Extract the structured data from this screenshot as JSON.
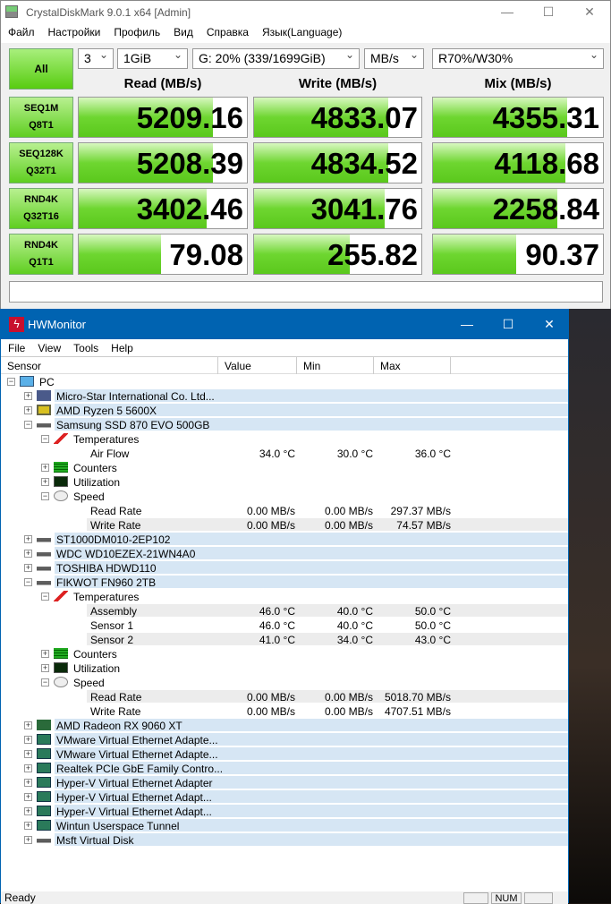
{
  "cdm": {
    "title": "CrystalDiskMark 9.0.1 x64 [Admin]",
    "menu": [
      "Файл",
      "Настройки",
      "Профиль",
      "Вид",
      "Справка",
      "Язык(Language)"
    ],
    "all_label": "All",
    "count": "3",
    "size": "1GiB",
    "drive": "G: 20% (339/1699GiB)",
    "unit": "MB/s",
    "mix_ratio": "R70%/W30%",
    "headers": [
      "Read (MB/s)",
      "Write (MB/s)",
      "Mix (MB/s)"
    ],
    "tests": [
      {
        "l1": "SEQ1M",
        "l2": "Q8T1",
        "values": [
          "5209.16",
          "4833.07",
          "4355.31"
        ],
        "fill": [
          0.8,
          0.8,
          0.79
        ]
      },
      {
        "l1": "SEQ128K",
        "l2": "Q32T1",
        "values": [
          "5208.39",
          "4834.52",
          "4118.68"
        ],
        "fill": [
          0.8,
          0.8,
          0.78
        ]
      },
      {
        "l1": "RND4K",
        "l2": "Q32T16",
        "values": [
          "3402.46",
          "3041.76",
          "2258.84"
        ],
        "fill": [
          0.76,
          0.78,
          0.73
        ]
      },
      {
        "l1": "RND4K",
        "l2": "Q1T1",
        "values": [
          "79.08",
          "255.82",
          "90.37"
        ],
        "fill": [
          0.49,
          0.57,
          0.49
        ]
      }
    ],
    "comment": ""
  },
  "hw": {
    "title": "HWMonitor",
    "menu": [
      "File",
      "View",
      "Tools",
      "Help"
    ],
    "columns": [
      "Sensor",
      "Value",
      "Min",
      "Max"
    ],
    "rows": [
      {
        "lvl": 0,
        "type": "root",
        "icon": "monitor-icon",
        "label": "PC"
      },
      {
        "lvl": 1,
        "type": "dev",
        "icon": "motherboard-icon",
        "label": "Micro-Star International Co. Ltd..."
      },
      {
        "lvl": 1,
        "type": "dev",
        "icon": "cpu-icon",
        "label": "AMD Ryzen 5 5600X"
      },
      {
        "lvl": 1,
        "type": "devopen",
        "icon": "drive-icon",
        "label": "Samsung SSD 870 EVO 500GB"
      },
      {
        "lvl": 2,
        "type": "grpopen",
        "icon": "thermometer-icon",
        "label": "Temperatures"
      },
      {
        "lvl": 3,
        "type": "leaf",
        "label": "Air Flow",
        "value": "34.0 °C",
        "min": "30.0 °C",
        "max": "36.0 °C"
      },
      {
        "lvl": 2,
        "type": "grp",
        "icon": "counters-icon",
        "label": "Counters"
      },
      {
        "lvl": 2,
        "type": "grp",
        "icon": "utilization-icon",
        "label": "Utilization"
      },
      {
        "lvl": 2,
        "type": "grpopen",
        "icon": "speed-icon",
        "label": "Speed"
      },
      {
        "lvl": 3,
        "type": "leaf",
        "label": "Read Rate",
        "value": "0.00 MB/s",
        "min": "0.00 MB/s",
        "max": "297.37 MB/s"
      },
      {
        "lvl": 3,
        "type": "leaf",
        "label": "Write Rate",
        "value": "0.00 MB/s",
        "min": "0.00 MB/s",
        "max": "74.57 MB/s"
      },
      {
        "lvl": 1,
        "type": "dev",
        "icon": "drive-icon",
        "label": "ST1000DM010-2EP102"
      },
      {
        "lvl": 1,
        "type": "dev",
        "icon": "drive-icon",
        "label": "WDC WD10EZEX-21WN4A0"
      },
      {
        "lvl": 1,
        "type": "dev",
        "icon": "drive-icon",
        "label": "TOSHIBA HDWD110"
      },
      {
        "lvl": 1,
        "type": "devopen",
        "icon": "drive-icon",
        "label": "FIKWOT FN960 2TB"
      },
      {
        "lvl": 2,
        "type": "grpopen",
        "icon": "thermometer-icon",
        "label": "Temperatures"
      },
      {
        "lvl": 3,
        "type": "leaf",
        "label": "Assembly",
        "value": "46.0 °C",
        "min": "40.0 °C",
        "max": "50.0 °C"
      },
      {
        "lvl": 3,
        "type": "leaf",
        "label": "Sensor 1",
        "value": "46.0 °C",
        "min": "40.0 °C",
        "max": "50.0 °C"
      },
      {
        "lvl": 3,
        "type": "leaf",
        "label": "Sensor 2",
        "value": "41.0 °C",
        "min": "34.0 °C",
        "max": "43.0 °C"
      },
      {
        "lvl": 2,
        "type": "grp",
        "icon": "counters-icon",
        "label": "Counters"
      },
      {
        "lvl": 2,
        "type": "grp",
        "icon": "utilization-icon",
        "label": "Utilization"
      },
      {
        "lvl": 2,
        "type": "grpopen",
        "icon": "speed-icon",
        "label": "Speed"
      },
      {
        "lvl": 3,
        "type": "leaf",
        "label": "Read Rate",
        "value": "0.00 MB/s",
        "min": "0.00 MB/s",
        "max": "5018.70 MB/s"
      },
      {
        "lvl": 3,
        "type": "leaf",
        "label": "Write Rate",
        "value": "0.00 MB/s",
        "min": "0.00 MB/s",
        "max": "4707.51 MB/s"
      },
      {
        "lvl": 1,
        "type": "dev",
        "icon": "gpu-icon",
        "label": "AMD Radeon RX 9060 XT"
      },
      {
        "lvl": 1,
        "type": "dev",
        "icon": "network-icon",
        "label": "VMware Virtual Ethernet Adapte..."
      },
      {
        "lvl": 1,
        "type": "dev",
        "icon": "network-icon",
        "label": "VMware Virtual Ethernet Adapte..."
      },
      {
        "lvl": 1,
        "type": "dev",
        "icon": "network-icon",
        "label": "Realtek PCIe GbE Family Contro..."
      },
      {
        "lvl": 1,
        "type": "dev",
        "icon": "network-icon",
        "label": "Hyper-V Virtual Ethernet Adapter"
      },
      {
        "lvl": 1,
        "type": "dev",
        "icon": "network-icon",
        "label": "Hyper-V Virtual Ethernet Adapt..."
      },
      {
        "lvl": 1,
        "type": "dev",
        "icon": "network-icon",
        "label": "Hyper-V Virtual Ethernet Adapt..."
      },
      {
        "lvl": 1,
        "type": "dev",
        "icon": "network-icon",
        "label": "Wintun Userspace Tunnel"
      },
      {
        "lvl": 1,
        "type": "dev",
        "icon": "drive-icon",
        "label": "Msft     Virtual Disk"
      }
    ],
    "status": "Ready",
    "num": "NUM"
  }
}
